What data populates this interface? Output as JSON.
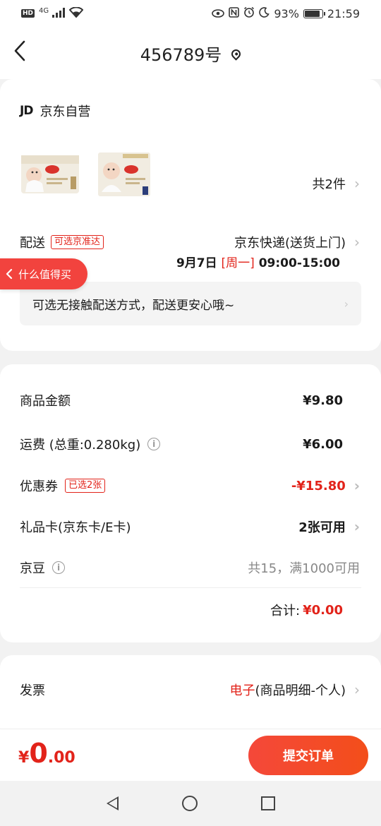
{
  "status_bar": {
    "hd": "HD",
    "network": "4G",
    "battery": "93%",
    "battery_level": 0.93,
    "time": "21:59"
  },
  "nav": {
    "title": "456789号"
  },
  "store": {
    "logo": "JD",
    "name": "京东自营"
  },
  "items": {
    "count_label": "共2件"
  },
  "delivery": {
    "label": "配送",
    "tag": "可选京准达",
    "method": "京东快递(送货上门)",
    "date": "9月7日",
    "weekday": "[周一]",
    "time_window": "09:00-15:00",
    "contactless_tip": "可选无接触配送方式，配送更安心哦~"
  },
  "float_tab": {
    "label": "什么值得买"
  },
  "price": {
    "goods_label": "商品金额",
    "goods_value": "¥9.80",
    "freight_label": "运费 (总重:0.280kg)",
    "freight_value": "¥6.00",
    "coupon_label": "优惠券",
    "coupon_tag": "已选2张",
    "coupon_value": "-¥15.80",
    "giftcard_label": "礼品卡(京东卡/E卡)",
    "giftcard_value": "2张可用",
    "jingdou_label": "京豆",
    "jingdou_value": "共15，满1000可用",
    "total_label": "合计:",
    "total_value": "¥0.00"
  },
  "invoice": {
    "label": "发票",
    "type": "电子",
    "detail": "(商品明细-个人)"
  },
  "bottom": {
    "currency": "¥",
    "amount_int": "0",
    "amount_dec": ".00",
    "submit_label": "提交订单"
  },
  "colors": {
    "accent": "#e2231a",
    "submit_start": "#f4483a",
    "submit_end": "#f34e1a"
  }
}
